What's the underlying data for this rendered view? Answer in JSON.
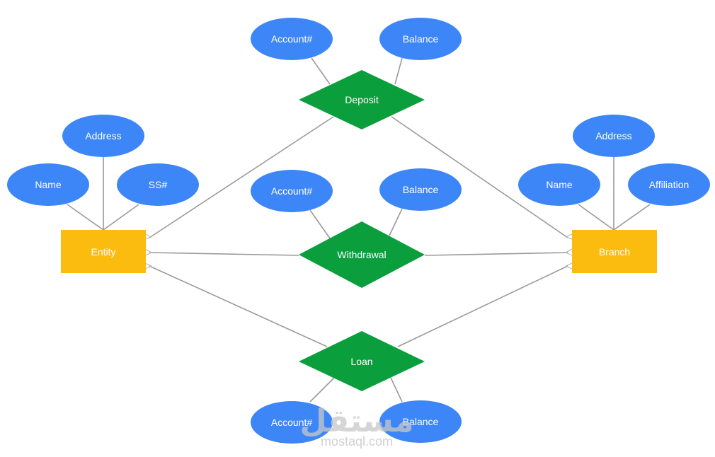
{
  "colors": {
    "attribute": "#3d86f7",
    "relationship": "#0a9e3d",
    "entity": "#fbbc0f",
    "connector": "#9a9a9a",
    "text": "#ffffff"
  },
  "entities": [
    {
      "id": "entity",
      "label": "Entity"
    },
    {
      "id": "branch",
      "label": "Branch"
    }
  ],
  "relationships": [
    {
      "id": "deposit",
      "label": "Deposit"
    },
    {
      "id": "withdrawal",
      "label": "Withdrawal"
    },
    {
      "id": "loan",
      "label": "Loan"
    }
  ],
  "attributes": {
    "entity": [
      {
        "id": "entity-address",
        "label": "Address"
      },
      {
        "id": "entity-name",
        "label": "Name"
      },
      {
        "id": "entity-ss",
        "label": "SS#"
      }
    ],
    "branch": [
      {
        "id": "branch-address",
        "label": "Address"
      },
      {
        "id": "branch-name",
        "label": "Name"
      },
      {
        "id": "branch-affiliation",
        "label": "Affiliation"
      }
    ],
    "deposit": [
      {
        "id": "deposit-account",
        "label": "Account#"
      },
      {
        "id": "deposit-balance",
        "label": "Balance"
      }
    ],
    "withdrawal": [
      {
        "id": "withdrawal-account",
        "label": "Account#"
      },
      {
        "id": "withdrawal-balance",
        "label": "Balance"
      }
    ],
    "loan": [
      {
        "id": "loan-account",
        "label": "Account#"
      },
      {
        "id": "loan-balance",
        "label": "Balance"
      }
    ]
  },
  "watermark": {
    "arabic": "مستقل",
    "latin": "mostaql.com"
  }
}
